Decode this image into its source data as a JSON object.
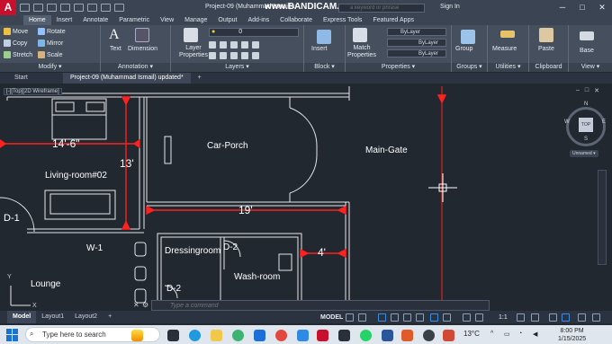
{
  "titlebar": {
    "logo": "A",
    "doc_title": "Project-09 (Muhammad Ismail) u",
    "watermark": "www.BANDICAM.com",
    "search_placeholder": "a keyword or phrase",
    "signin": "Sign In",
    "minimize": "─",
    "maximize": "□",
    "close": "✕"
  },
  "menu": [
    "Home",
    "Insert",
    "Annotate",
    "Parametric",
    "View",
    "Manage",
    "Output",
    "Add-ins",
    "Collaborate",
    "Express Tools",
    "Featured Apps"
  ],
  "ribbon": {
    "modify": {
      "title": "Modify ▾",
      "move": "Move",
      "rotate": "Rotate",
      "copy": "Copy",
      "mirror": "Mirror",
      "stretch": "Stretch",
      "scale": "Scale"
    },
    "annotation": {
      "title": "Annotation ▾",
      "text": "Text",
      "dimension": "Dimension"
    },
    "layers": {
      "title": "Layers ▾",
      "layer_properties": "Layer Properties",
      "layer_value": "0"
    },
    "block": {
      "title": "Block ▾",
      "insert": "Insert"
    },
    "properties": {
      "title": "Properties ▾",
      "match": "Match Properties",
      "bylayer1": "ByLayer",
      "bylayer2": "ByLayer",
      "bylayer3": "ByLayer"
    },
    "groups": {
      "title": "Groups ▾",
      "group": "Group"
    },
    "utilities": {
      "title": "Utilities ▾",
      "measure": "Measure"
    },
    "clipboard": {
      "title": "Clipboard",
      "paste": "Paste"
    },
    "view": {
      "title": "View ▾",
      "base": "Base"
    }
  },
  "filetabs": [
    "Start",
    "Project-09 (Muhammad Ismail) updated*"
  ],
  "viewport": {
    "label": "[-][Top][2D Wireframe]",
    "restore": "–",
    "max": "□",
    "close": "✕",
    "viewcube_top": "TOP",
    "n": "N",
    "s": "S",
    "e": "E",
    "w": "W",
    "unnamed": "Unnamed ▾"
  },
  "drawing": {
    "dim_14_6": "14'-6\"",
    "dim_13": "13'",
    "dim_19": "19'",
    "dim_4": "4'",
    "living_room": "Living-room#02",
    "car_porch": "Car-Porch",
    "main_gate": "Main-Gate",
    "d1": "D-1",
    "d2a": "D-2",
    "d2b": "D-2",
    "w1": "W-1",
    "dressing": "Dressingroom",
    "wash": "Wash-room",
    "lounge": "Lounge",
    "ucs_y": "Y",
    "ucs_x": "X"
  },
  "command": {
    "placeholder": "Type a command"
  },
  "statusbar": {
    "tabs": [
      "Model",
      "Layout1",
      "Layout2"
    ],
    "add": "+",
    "model": "MODEL",
    "scale": "1:1"
  },
  "taskbar": {
    "search": "Type here to search",
    "temp": "13°C",
    "time": "8:00 PM",
    "date": "1/15/2025"
  },
  "colors": {
    "accent": "#c8102e",
    "dim": "#ff2020",
    "wall": "#e8e8e8",
    "canvas": "#212830"
  }
}
